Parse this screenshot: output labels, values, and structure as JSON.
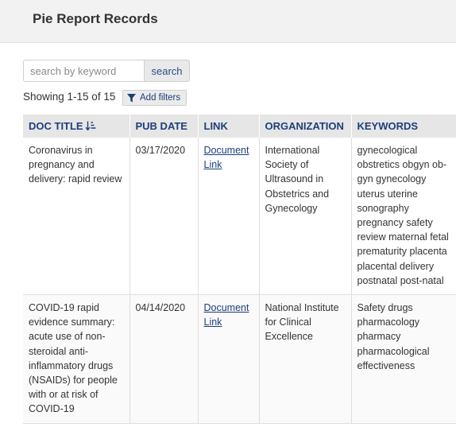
{
  "header": {
    "title": "Pie Report Records"
  },
  "search": {
    "placeholder": "search by keyword",
    "button_label": "search"
  },
  "results": {
    "showing_text": "Showing 1-15 of 15",
    "add_filters_label": "Add filters"
  },
  "table": {
    "headers": {
      "doc_title": "DOC TITLE",
      "pub_date": "PUB DATE",
      "link": "LINK",
      "organization": "ORGANIZATION",
      "keywords": "KEYWORDS"
    },
    "rows": [
      {
        "title": "Coronavirus in pregnancy and delivery: rapid review",
        "pub_date": "03/17/2020",
        "link": "Document Link",
        "organization": "International Society of Ultrasound in Obstetrics and Gynecology",
        "keywords": "gynecological obstretics obgyn ob-gyn gynecology uterus uterine sonography pregnancy safety review maternal fetal prematurity placenta placental delivery postnatal post-natal"
      },
      {
        "title": "COVID-19 rapid evidence summary: acute use of non-steroidal anti-inflammatory drugs (NSAIDs) for people with or at risk of COVID-19",
        "pub_date": "04/14/2020",
        "link": "Document Link",
        "organization": "National Institute for Clinical Excellence",
        "keywords": "Safety drugs pharmacology pharmacy pharmacological effectiveness"
      }
    ]
  },
  "icons": {
    "sort": "sort-ascending-icon",
    "filter": "funnel-icon"
  },
  "colors": {
    "accent": "#1d3f7a",
    "header_bg": "#f2f2f2",
    "table_header_bg": "#e6e6e6"
  }
}
